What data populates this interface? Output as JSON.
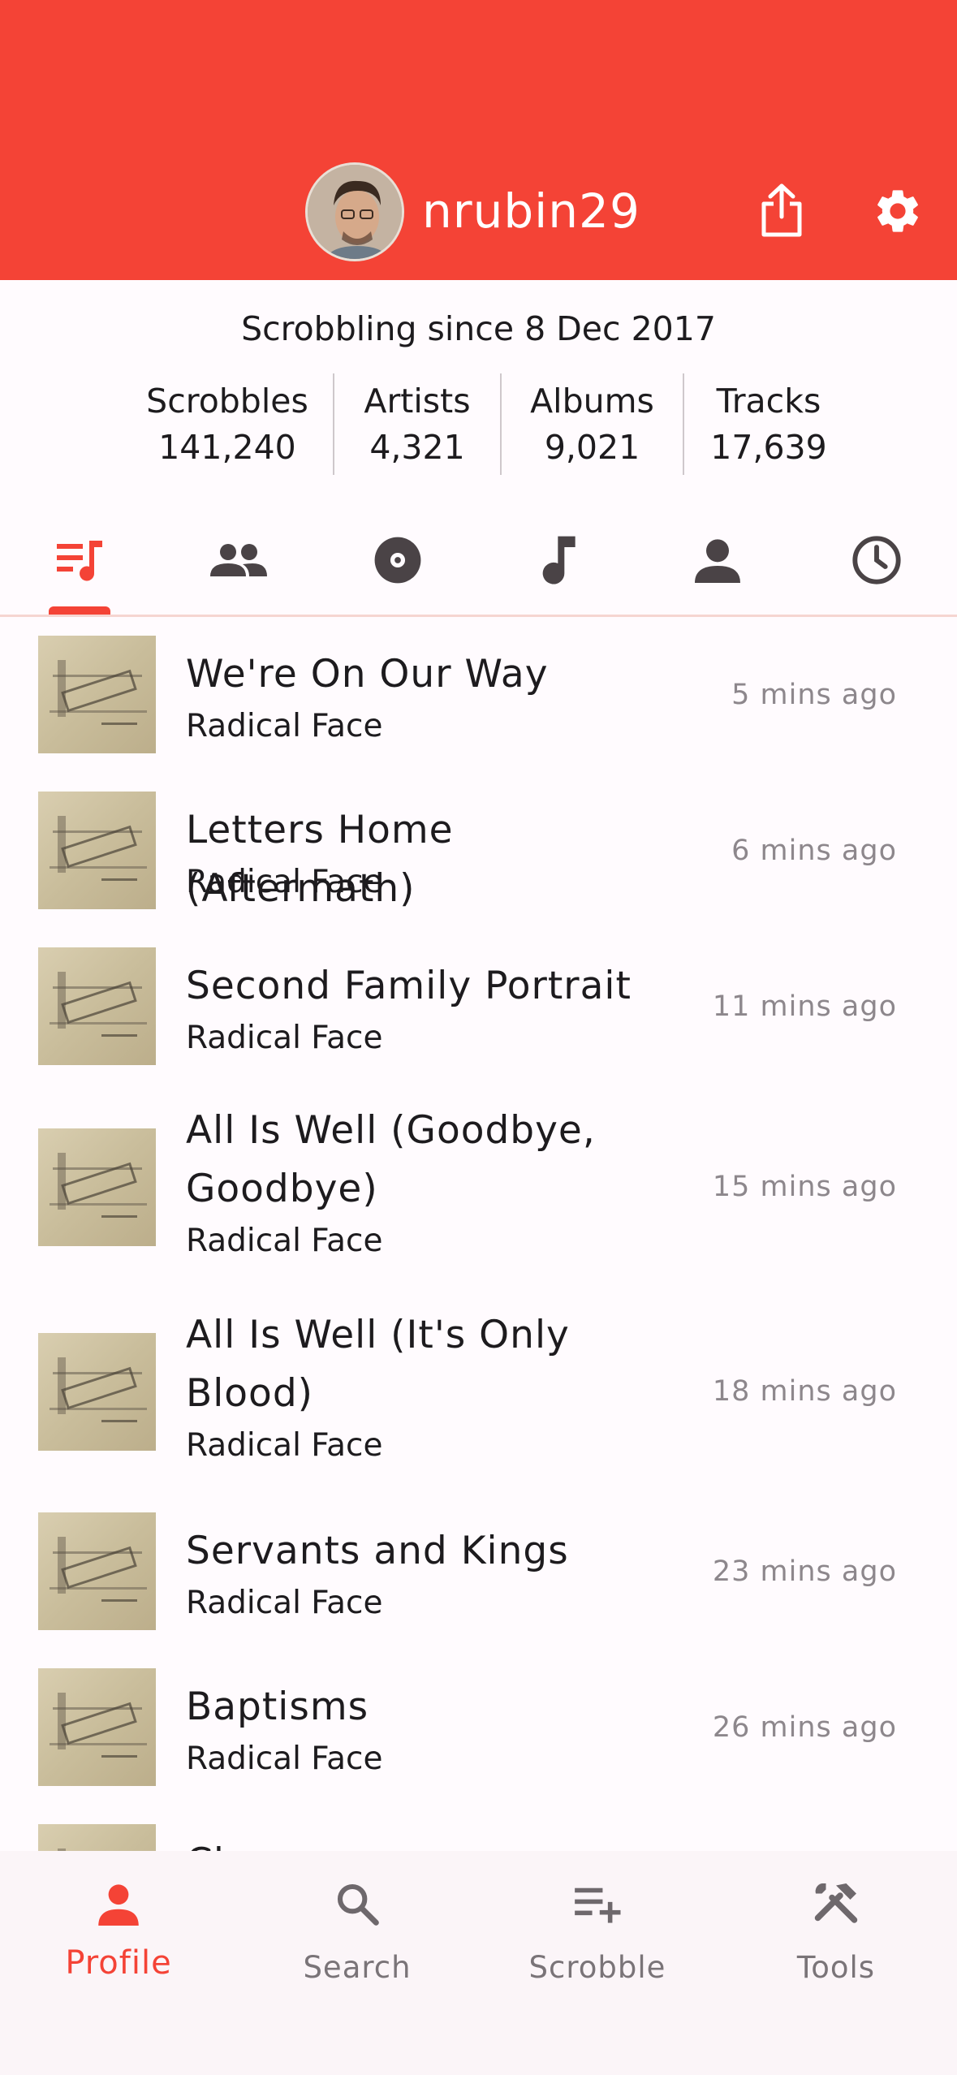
{
  "colors": {
    "accent": "#f44336",
    "text": "#1d1b1e",
    "muted": "#8d878c"
  },
  "header": {
    "username": "nrubin29",
    "icons": [
      "avatar",
      "share-icon",
      "settings-gear-icon"
    ]
  },
  "profile": {
    "since": "Scrobbling since 8 Dec 2017",
    "stats": [
      {
        "label": "Scrobbles",
        "value": "141,240"
      },
      {
        "label": "Artists",
        "value": "4,321"
      },
      {
        "label": "Albums",
        "value": "9,021"
      },
      {
        "label": "Tracks",
        "value": "17,639"
      }
    ]
  },
  "tabs": [
    "recent-scrobbles-icon",
    "friends-icon",
    "album-icon",
    "track-icon",
    "artist-icon",
    "history-icon"
  ],
  "scrobbles": [
    {
      "title": "We're On Our Way",
      "artist": "Radical Face",
      "time": "5 mins ago"
    },
    {
      "title": "Letters Home (Aftermath)",
      "artist": "Radical Face",
      "time": "6 mins ago"
    },
    {
      "title": "Second Family Portrait",
      "artist": "Radical Face",
      "time": "11 mins ago"
    },
    {
      "title": "All Is Well (Goodbye, Goodbye)",
      "artist": "Radical Face",
      "time": "15 mins ago"
    },
    {
      "title": "All Is Well (It's Only Blood)",
      "artist": "Radical Face",
      "time": "18 mins ago"
    },
    {
      "title": "Servants and Kings",
      "artist": "Radical Face",
      "time": "23 mins ago"
    },
    {
      "title": "Baptisms",
      "artist": "Radical Face",
      "time": "26 mins ago"
    },
    {
      "title": "Cl…",
      "artist": "",
      "time": ""
    }
  ],
  "bottom_nav": [
    {
      "label": "Profile",
      "icon": "person-icon",
      "active": true
    },
    {
      "label": "Search",
      "icon": "search-icon",
      "active": false
    },
    {
      "label": "Scrobble",
      "icon": "playlist-add-icon",
      "active": false
    },
    {
      "label": "Tools",
      "icon": "tools-icon",
      "active": false
    }
  ]
}
